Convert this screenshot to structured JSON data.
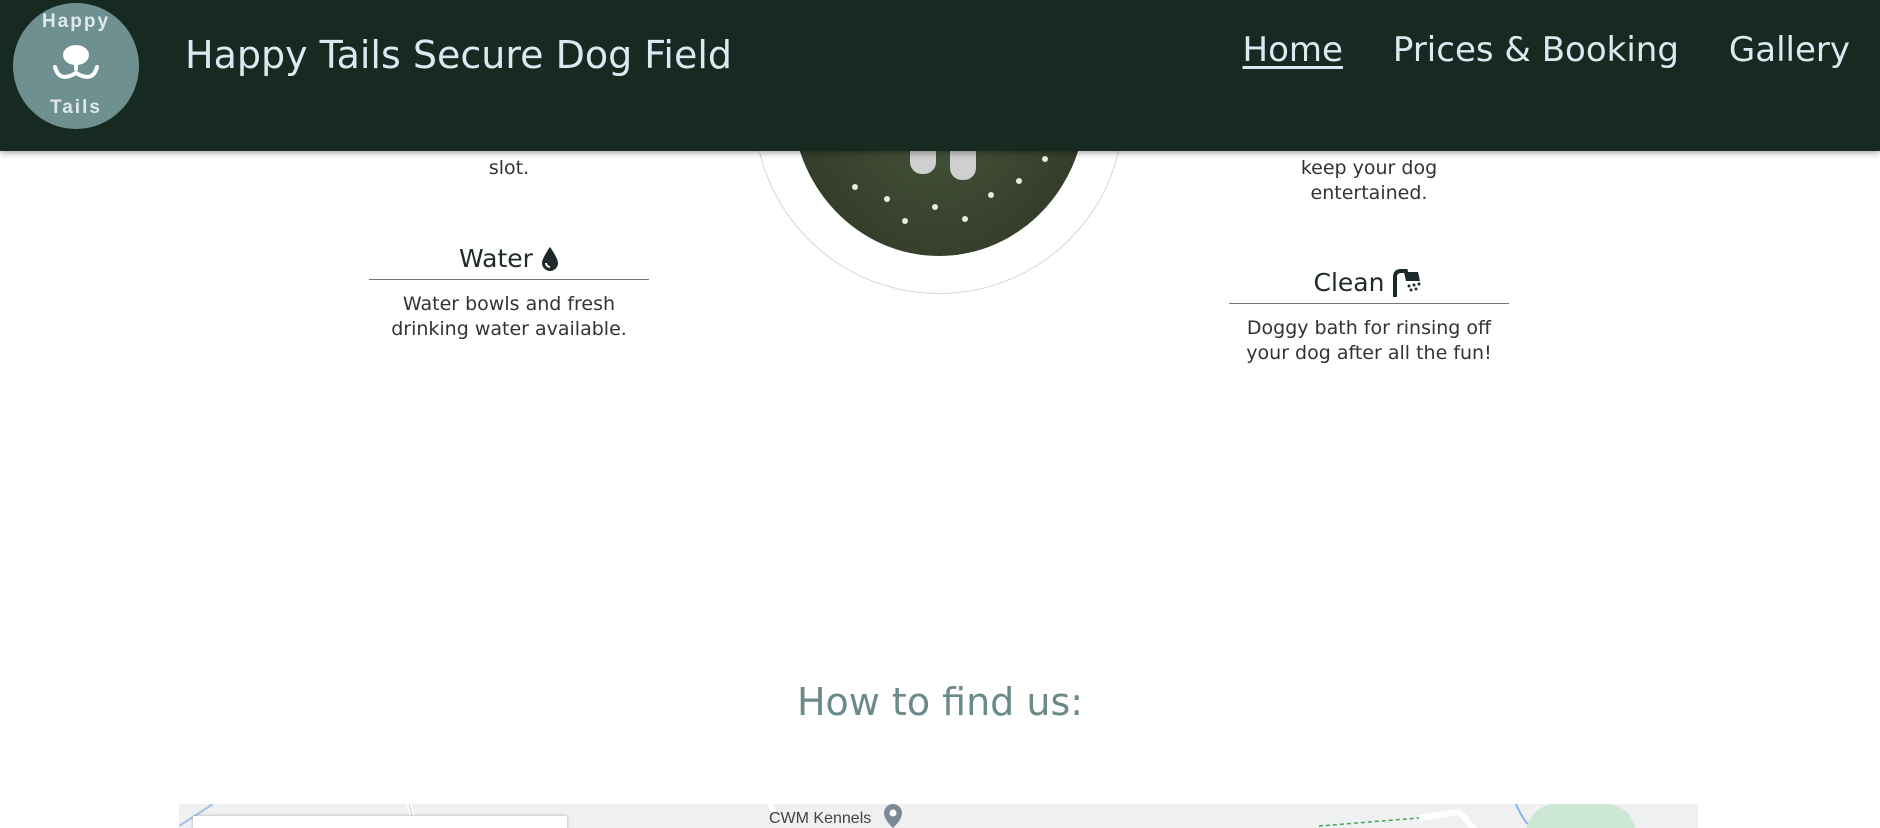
{
  "header": {
    "logo_top": "Happy",
    "logo_bottom": "Tails",
    "site_title": "Happy Tails Secure Dog Field",
    "nav": [
      {
        "label": "Home",
        "active": true
      },
      {
        "label": "Prices & Booking",
        "active": false
      },
      {
        "label": "Gallery",
        "active": false
      }
    ]
  },
  "features": {
    "left_partial": "slot.",
    "right_partial_1": "keep your dog",
    "right_partial_2": "entertained.",
    "water": {
      "title": "Water",
      "icon": "water-drop-icon",
      "text": "Water bowls and fresh drinking water available."
    },
    "clean": {
      "title": "Clean",
      "icon": "shower-icon",
      "text": "Doggy bath for rinsing off your dog after all the fun!"
    }
  },
  "find_us": {
    "title": "How to find us:"
  },
  "map": {
    "place_label": "CWM Kennels",
    "pin_icon": "map-pin-icon"
  },
  "colors": {
    "header_bg": "#172a21",
    "nav_text": "#dfe8f2",
    "logo_bg": "#6f9090",
    "find_title": "#6b8a8a"
  }
}
